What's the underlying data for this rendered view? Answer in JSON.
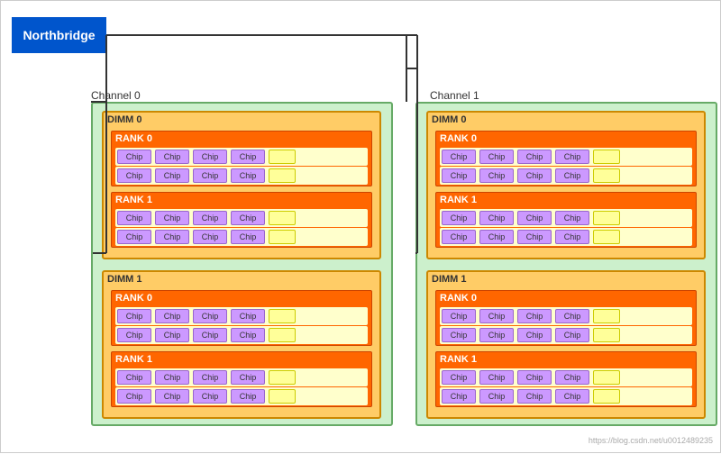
{
  "northbridge": {
    "label": "Northbridge"
  },
  "channels": [
    {
      "label": "Channel 0",
      "dimms": [
        {
          "label": "DIMM 0",
          "ranks": [
            {
              "label": "RANK 0",
              "rows": [
                [
                  "Chip",
                  "Chip",
                  "Chip",
                  "Chip"
                ],
                [
                  "Chip",
                  "Chip",
                  "Chip",
                  "Chip"
                ]
              ]
            },
            {
              "label": "RANK 1",
              "rows": [
                [
                  "Chip",
                  "Chip",
                  "Chip",
                  "Chip"
                ],
                [
                  "Chip",
                  "Chip",
                  "Chip",
                  "Chip"
                ]
              ]
            }
          ]
        },
        {
          "label": "DIMM 1",
          "ranks": [
            {
              "label": "RANK 0",
              "rows": [
                [
                  "Chip",
                  "Chip",
                  "Chip",
                  "Chip"
                ],
                [
                  "Chip",
                  "Chip",
                  "Chip",
                  "Chip"
                ]
              ]
            },
            {
              "label": "RANK 1",
              "rows": [
                [
                  "Chip",
                  "Chip",
                  "Chip",
                  "Chip"
                ],
                [
                  "Chip",
                  "Chip",
                  "Chip",
                  "Chip"
                ]
              ]
            }
          ]
        }
      ]
    },
    {
      "label": "Channel 1",
      "dimms": [
        {
          "label": "DIMM 0",
          "ranks": [
            {
              "label": "RANK 0",
              "rows": [
                [
                  "Chip",
                  "Chip",
                  "Chip",
                  "Chip"
                ],
                [
                  "Chip",
                  "Chip",
                  "Chip",
                  "Chip"
                ]
              ]
            },
            {
              "label": "RANK 1",
              "rows": [
                [
                  "Chip",
                  "Chip",
                  "Chip",
                  "Chip"
                ],
                [
                  "Chip",
                  "Chip",
                  "Chip",
                  "Chip"
                ]
              ]
            }
          ]
        },
        {
          "label": "DIMM 1",
          "ranks": [
            {
              "label": "RANK 0",
              "rows": [
                [
                  "Chip",
                  "Chip",
                  "Chip",
                  "Chip"
                ],
                [
                  "Chip",
                  "Chip",
                  "Chip",
                  "Chip"
                ]
              ]
            },
            {
              "label": "RANK 1",
              "rows": [
                [
                  "Chip",
                  "Chip",
                  "Chip",
                  "Chip"
                ],
                [
                  "Chip",
                  "Chip",
                  "Chip",
                  "Chip"
                ]
              ]
            }
          ]
        }
      ]
    }
  ],
  "watermark": "https://blog.csdn.net/u0012489235"
}
